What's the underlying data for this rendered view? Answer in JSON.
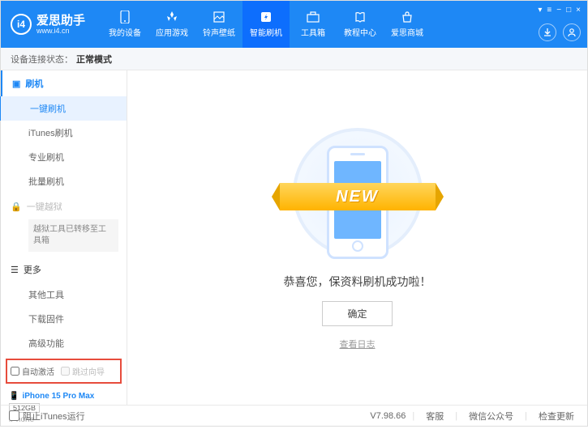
{
  "header": {
    "app_name": "爱思助手",
    "url": "www.i4.cn",
    "nav": [
      {
        "label": "我的设备",
        "icon": "phone"
      },
      {
        "label": "应用游戏",
        "icon": "apps"
      },
      {
        "label": "铃声壁纸",
        "icon": "music"
      },
      {
        "label": "智能刷机",
        "icon": "flash"
      },
      {
        "label": "工具箱",
        "icon": "toolbox"
      },
      {
        "label": "教程中心",
        "icon": "book"
      },
      {
        "label": "爱思商城",
        "icon": "cart"
      }
    ]
  },
  "status_bar": {
    "label": "设备连接状态：",
    "mode": "正常模式"
  },
  "sidebar": {
    "flash": {
      "title": "刷机",
      "items": [
        "一键刷机",
        "iTunes刷机",
        "专业刷机",
        "批量刷机"
      ]
    },
    "jailbreak": {
      "title": "一键越狱",
      "note": "越狱工具已转移至工具箱"
    },
    "more": {
      "title": "更多",
      "items": [
        "其他工具",
        "下载固件",
        "高级功能"
      ]
    },
    "checks": {
      "auto_activate": "自动激活",
      "skip_guide": "跳过向导"
    },
    "device": {
      "name": "iPhone 15 Pro Max",
      "storage": "512GB",
      "type": "iPhone"
    }
  },
  "main": {
    "ribbon": "NEW",
    "message": "恭喜您，保资料刷机成功啦！",
    "ok": "确定",
    "view_log": "查看日志"
  },
  "footer": {
    "block_itunes": "阻止iTunes运行",
    "version": "V7.98.66",
    "links": [
      "客服",
      "微信公众号",
      "检查更新"
    ]
  }
}
